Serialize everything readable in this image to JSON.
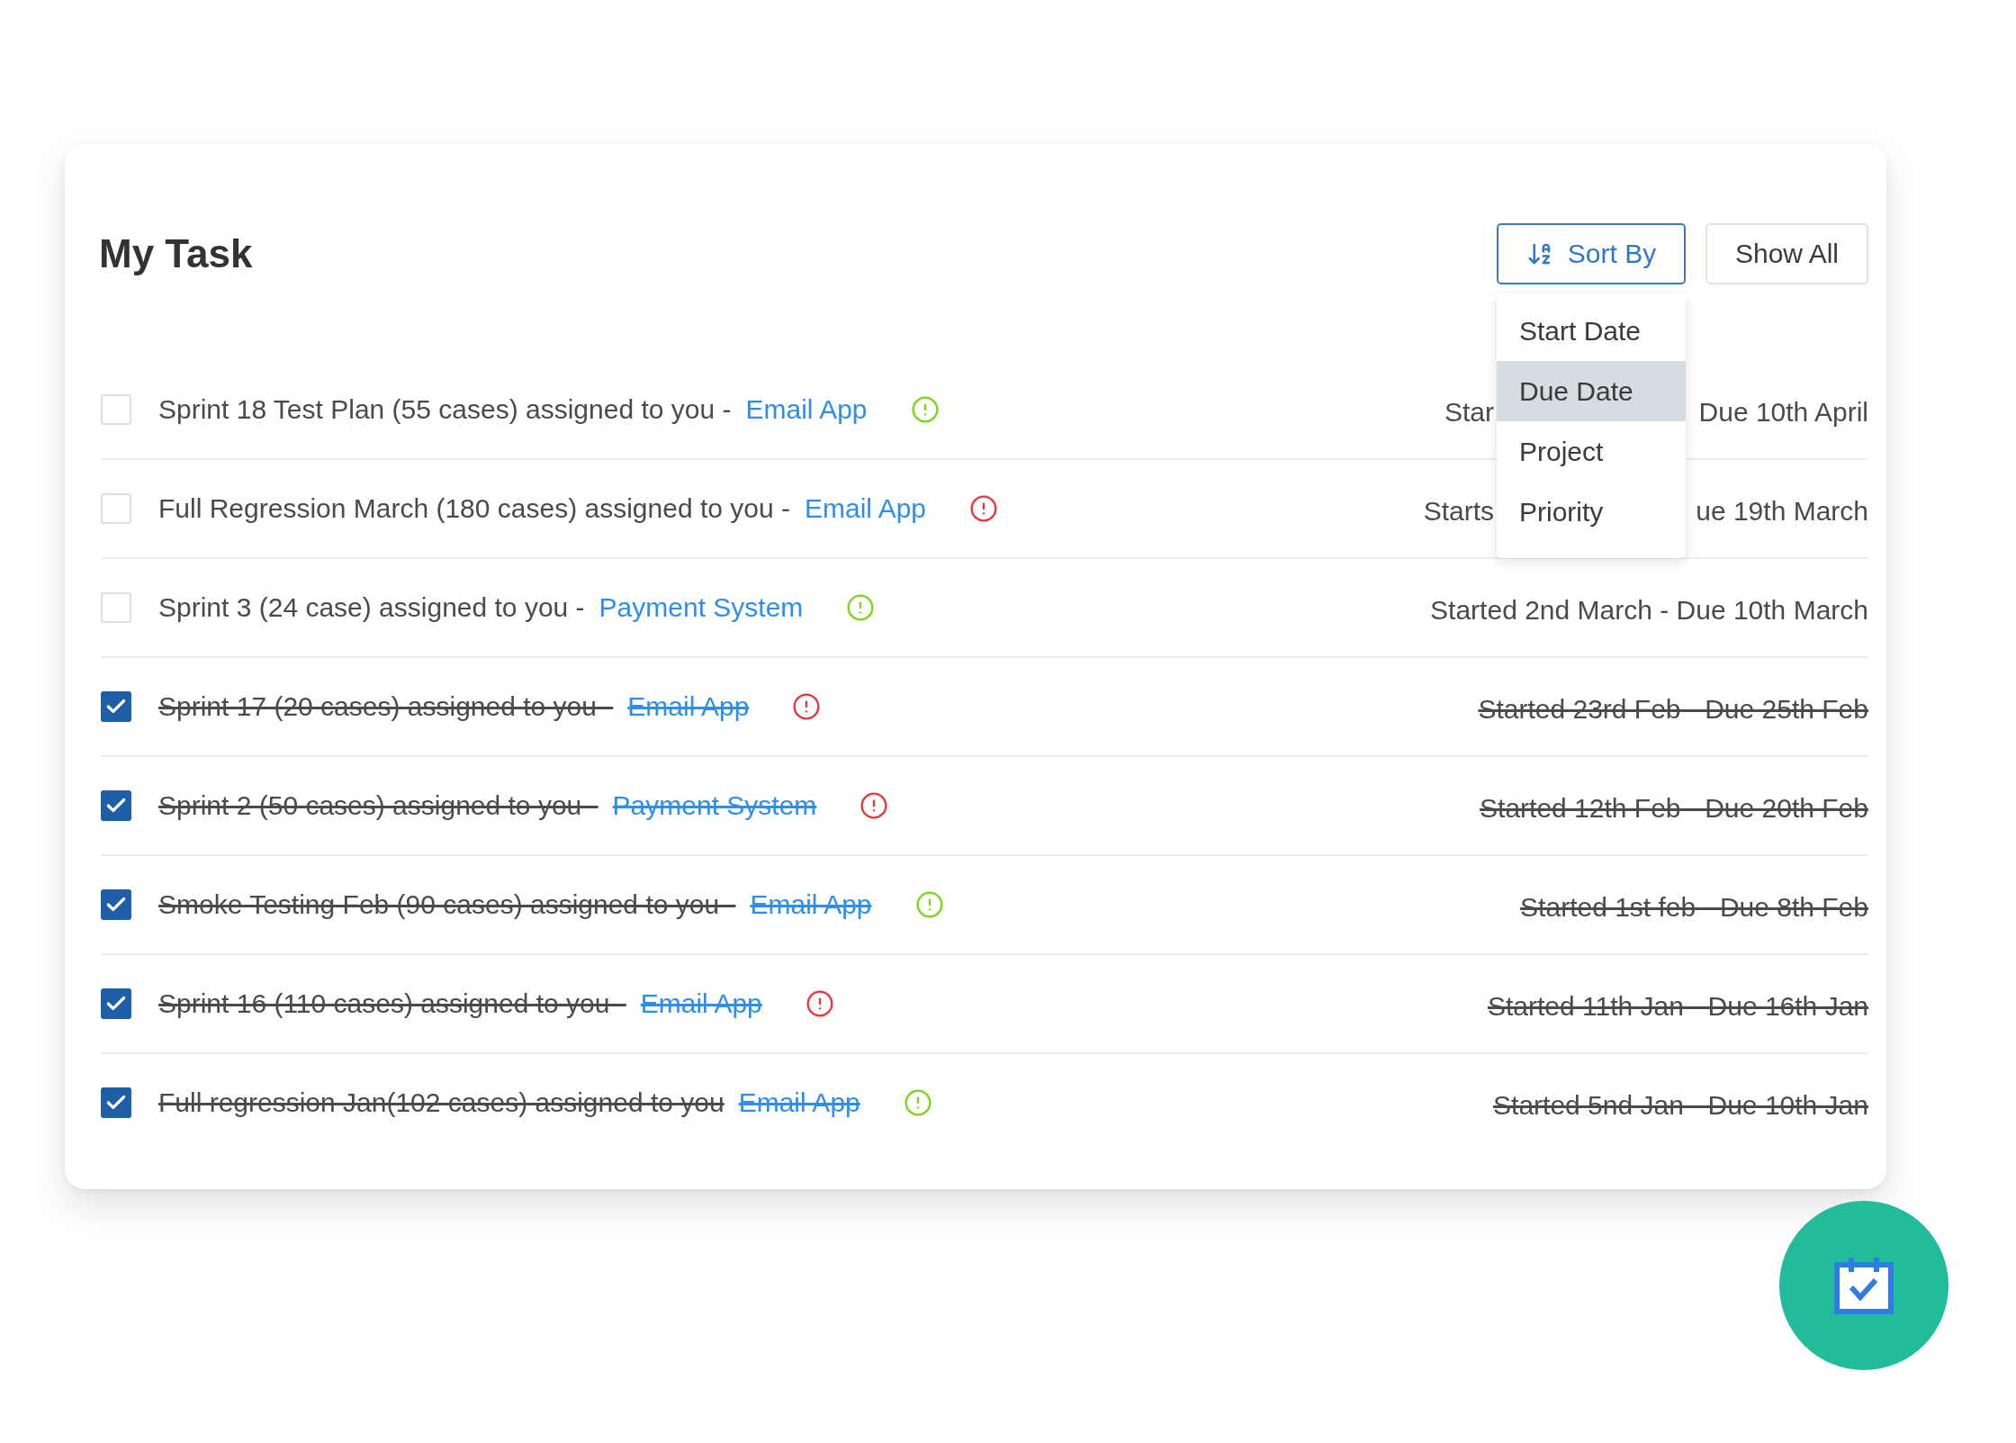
{
  "title": "My Task",
  "sort_button": {
    "label": "Sort By"
  },
  "show_all_button": {
    "label": "Show All"
  },
  "sort_menu": [
    {
      "label": "Start Date",
      "selected": false
    },
    {
      "label": "Due Date",
      "selected": true
    },
    {
      "label": "Project",
      "selected": false
    },
    {
      "label": "Priority",
      "selected": false
    }
  ],
  "tasks": [
    {
      "checked": false,
      "title": "Sprint 18 Test Plan (55 cases) assigned to you -",
      "project": "Email App",
      "color": "#7ed321",
      "date_before_menu": "Star",
      "date_after_menu": "Due 10th April"
    },
    {
      "checked": false,
      "title": "Full Regression March (180 cases) assigned to you -",
      "project": "Email App",
      "color": "#e0393e",
      "date_before_menu": "Starts",
      "date_after_menu": "ue 19th March"
    },
    {
      "checked": false,
      "title": "Sprint 3 (24 case) assigned to you -",
      "project": "Payment System",
      "color": "#7ed321",
      "date": "Started 2nd March - Due 10th March"
    },
    {
      "checked": true,
      "title": "Sprint 17 (20 cases) assigned to you -",
      "project": "Email App",
      "color": "#e0393e",
      "date": "Started 23rd Feb - Due 25th Feb"
    },
    {
      "checked": true,
      "title": "Sprint 2 (50 cases) assigned to you -",
      "project": "Payment System",
      "color": "#e0393e",
      "date": "Started 12th Feb - Due 20th Feb"
    },
    {
      "checked": true,
      "title": "Smoke Testing Feb (90 cases) assigned to you -",
      "project": "Email App",
      "color": "#7ed321",
      "date": "Started 1st feb - Due 8th Feb"
    },
    {
      "checked": true,
      "title": "Sprint 16 (110 cases) assigned to you -",
      "project": "Email App",
      "color": "#e0393e",
      "date": "Started 11th Jan - Due 16th Jan"
    },
    {
      "checked": true,
      "title": "Full regression Jan(102 cases) assigned to you",
      "project": "Email App",
      "color": "#7ed321",
      "date": "Started 5nd Jan - Due 10th Jan"
    }
  ]
}
